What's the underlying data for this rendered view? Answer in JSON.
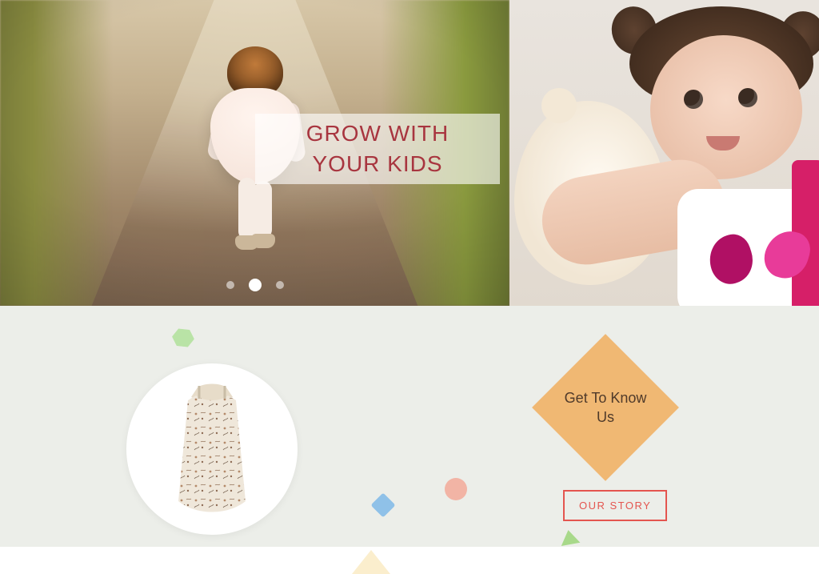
{
  "hero": {
    "overlay_line1": "GROW WITH",
    "overlay_line2": "YOUR KIDS",
    "slide_count": 3,
    "active_slide_index": 1
  },
  "about": {
    "diamond_line1": "Get To Know",
    "diamond_line2": "Us",
    "cta_label": "OUR STORY"
  }
}
